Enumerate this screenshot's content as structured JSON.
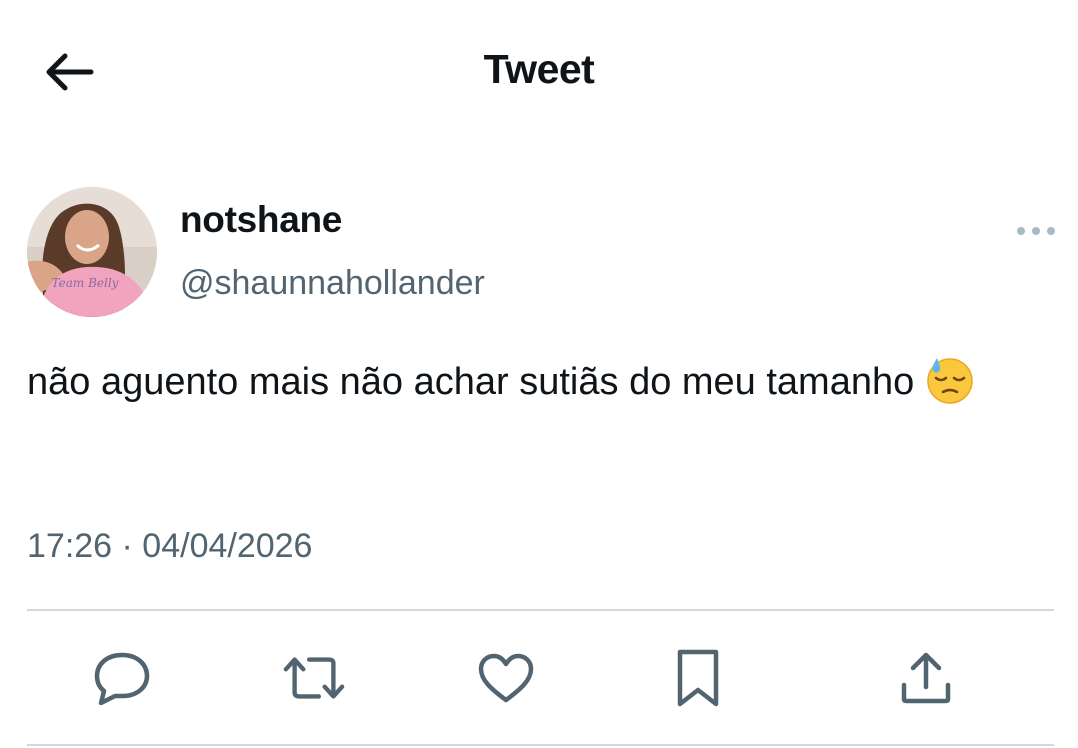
{
  "header": {
    "title": "Tweet",
    "back_icon": "arrow-left-icon"
  },
  "tweet": {
    "author": {
      "display_name": "notshane",
      "handle": "@shaunnahollander",
      "avatar_shirt_text": "Team Belly"
    },
    "text": "não aguento mais não achar sutiãs do meu tamanho",
    "emoji": "downcast-face-with-sweat",
    "timestamp": "17:26 · 04/04/2026",
    "more_icon": "more-horizontal-icon"
  },
  "actions": [
    {
      "name": "reply",
      "icon": "reply-icon"
    },
    {
      "name": "retweet",
      "icon": "retweet-icon"
    },
    {
      "name": "like",
      "icon": "heart-icon"
    },
    {
      "name": "bookmark",
      "icon": "bookmark-icon"
    },
    {
      "name": "share",
      "icon": "share-icon"
    }
  ],
  "colors": {
    "text_primary": "#0f1419",
    "text_secondary": "#536471",
    "divider": "#cfd9de",
    "icon": "#536471"
  }
}
